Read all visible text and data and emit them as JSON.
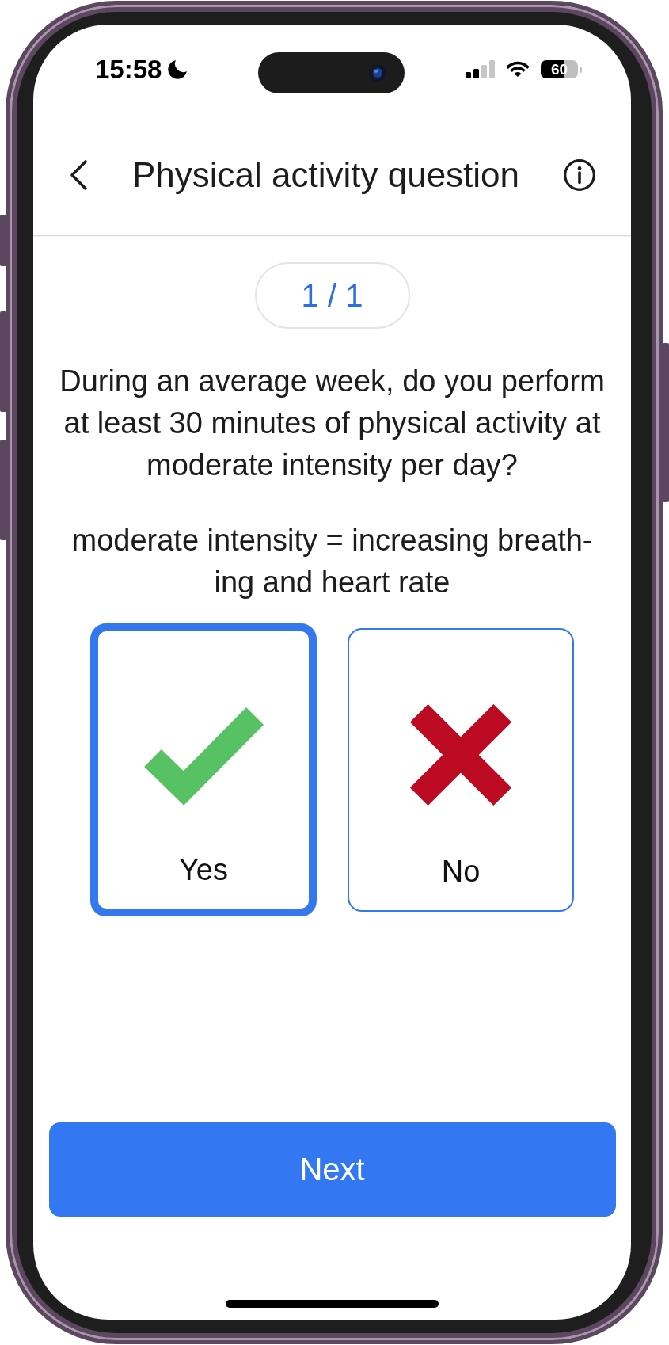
{
  "status_bar": {
    "time": "15:58",
    "battery": "60"
  },
  "header": {
    "title": "Physical activity question"
  },
  "progress": {
    "label": "1 / 1"
  },
  "question": {
    "text": "During an average week, do you perform at least 30 minutes of physical activity at moderate intensity per day?",
    "note": "moderate intensity = increasing breath-ing and heart rate"
  },
  "options": [
    {
      "label": "Yes",
      "kind": "yes",
      "selected": true
    },
    {
      "label": "No",
      "kind": "no",
      "selected": false
    }
  ],
  "buttons": {
    "next": "Next"
  }
}
